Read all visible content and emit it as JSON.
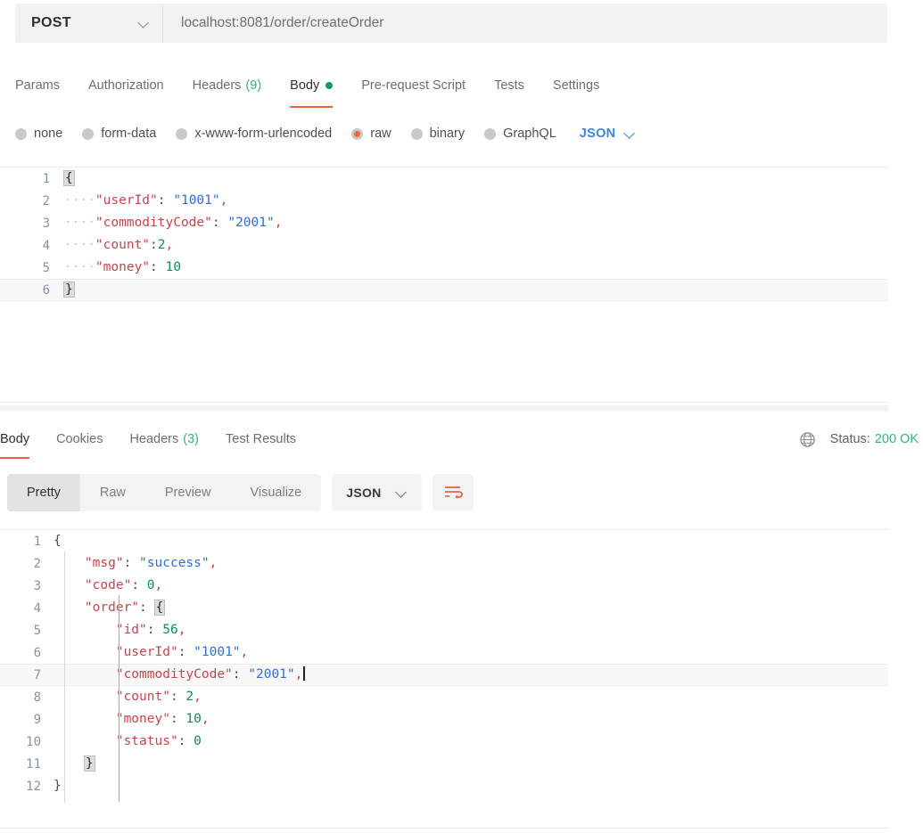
{
  "request": {
    "method": "POST",
    "url": "localhost:8081/order/createOrder",
    "method_caret_icon": "chevron-down-icon",
    "tabs": [
      {
        "label": "Params",
        "active": false,
        "badge": null,
        "dot": false
      },
      {
        "label": "Authorization",
        "active": false,
        "badge": null,
        "dot": false
      },
      {
        "label": "Headers",
        "active": false,
        "badge": "(9)",
        "dot": false
      },
      {
        "label": "Body",
        "active": true,
        "badge": null,
        "dot": true
      },
      {
        "label": "Pre-request Script",
        "active": false,
        "badge": null,
        "dot": false
      },
      {
        "label": "Tests",
        "active": false,
        "badge": null,
        "dot": false
      },
      {
        "label": "Settings",
        "active": false,
        "badge": null,
        "dot": false
      }
    ],
    "body_types": [
      {
        "label": "none",
        "selected": false
      },
      {
        "label": "form-data",
        "selected": false
      },
      {
        "label": "x-www-form-urlencoded",
        "selected": false
      },
      {
        "label": "raw",
        "selected": true
      },
      {
        "label": "binary",
        "selected": false
      },
      {
        "label": "GraphQL",
        "selected": false
      }
    ],
    "format_select": {
      "label": "JSON",
      "caret_icon": "chevron-down-icon"
    },
    "body_lines": [
      {
        "num": "1",
        "highlight": false
      },
      {
        "num": "2",
        "highlight": false
      },
      {
        "num": "3",
        "highlight": false
      },
      {
        "num": "4",
        "highlight": false
      },
      {
        "num": "5",
        "highlight": false
      },
      {
        "num": "6",
        "highlight": false
      }
    ],
    "body_text": {
      "l1_brace": "{",
      "l2_indent": "····",
      "l2_key": "\"userId\"",
      "l2_colon": ": ",
      "l2_val": "\"1001\"",
      "l2_comma": ",",
      "l3_indent": "····",
      "l3_key": "\"commodityCode\"",
      "l3_colon": ": ",
      "l3_val": "\"2001\"",
      "l3_comma": ",",
      "l4_indent": "····",
      "l4_key": "\"count\"",
      "l4_colon": ":",
      "l4_val": "2",
      "l4_comma": ",",
      "l5_indent": "····",
      "l5_key": "\"money\"",
      "l5_colon": ": ",
      "l5_val": "10",
      "l6_brace": "}"
    }
  },
  "response": {
    "tabs": [
      {
        "label": "Body",
        "active": true,
        "badge": null
      },
      {
        "label": "Cookies",
        "active": false,
        "badge": null
      },
      {
        "label": "Headers",
        "active": false,
        "badge": "(3)"
      },
      {
        "label": "Test Results",
        "active": false,
        "badge": null
      }
    ],
    "globe_icon": "globe-icon",
    "status_label": "Status:",
    "status_value": "200 OK",
    "view_modes": [
      {
        "label": "Pretty",
        "active": true
      },
      {
        "label": "Raw",
        "active": false
      },
      {
        "label": "Preview",
        "active": false
      },
      {
        "label": "Visualize",
        "active": false
      }
    ],
    "format_select": {
      "label": "JSON",
      "caret_icon": "chevron-down-icon"
    },
    "wrap_icon": "word-wrap-icon",
    "body_lines": [
      {
        "num": "1",
        "highlight": false
      },
      {
        "num": "2",
        "highlight": false
      },
      {
        "num": "3",
        "highlight": false
      },
      {
        "num": "4",
        "highlight": false
      },
      {
        "num": "5",
        "highlight": false
      },
      {
        "num": "6",
        "highlight": false
      },
      {
        "num": "7",
        "highlight": true
      },
      {
        "num": "8",
        "highlight": false
      },
      {
        "num": "9",
        "highlight": false
      },
      {
        "num": "10",
        "highlight": false
      },
      {
        "num": "11",
        "highlight": false
      },
      {
        "num": "12",
        "highlight": false
      }
    ],
    "body_text": {
      "l1": "{",
      "l2_key": "\"msg\"",
      "l2_colon": ": ",
      "l2_val": "\"success\"",
      "l2_comma": ",",
      "l3_key": "\"code\"",
      "l3_colon": ": ",
      "l3_val": "0",
      "l3_comma": ",",
      "l4_key": "\"order\"",
      "l4_colon": ": ",
      "l4_brace": "{",
      "l5_key": "\"id\"",
      "l5_colon": ": ",
      "l5_val": "56",
      "l5_comma": ",",
      "l6_key": "\"userId\"",
      "l6_colon": ": ",
      "l6_val": "\"1001\"",
      "l6_comma": ",",
      "l7_key": "\"commodityCode\"",
      "l7_colon": ": ",
      "l7_val": "\"2001\"",
      "l7_comma": ",",
      "l8_key": "\"count\"",
      "l8_colon": ": ",
      "l8_val": "2",
      "l8_comma": ",",
      "l9_key": "\"money\"",
      "l9_colon": ": ",
      "l9_val": "10",
      "l9_comma": ",",
      "l10_key": "\"status\"",
      "l10_colon": ": ",
      "l10_val": "0",
      "l11_brace": "}",
      "l12_brace": "}"
    }
  }
}
